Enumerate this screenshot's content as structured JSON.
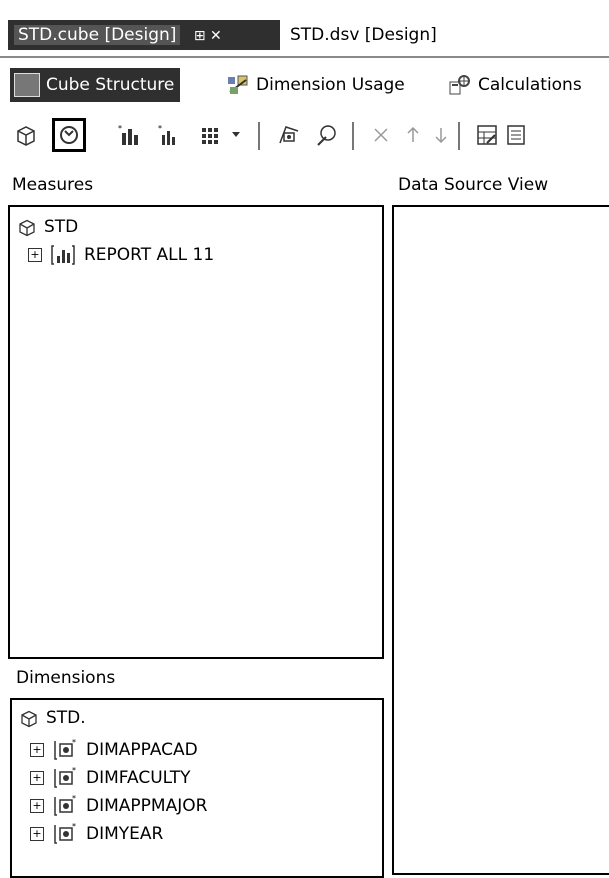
{
  "doc_tabs": [
    {
      "label": "STD.cube [Design]",
      "controls": "⊞ ✕"
    },
    {
      "label": "STD.dsv [Design]"
    }
  ],
  "sub_tabs": [
    {
      "label": "Cube Structure"
    },
    {
      "label": "Dimension Usage"
    },
    {
      "label": "Calculations"
    }
  ],
  "measures": {
    "header": "Measures",
    "root": "STD",
    "groups": [
      {
        "label": "REPORT ALL 11"
      }
    ]
  },
  "dsv": {
    "header": "Data Source View"
  },
  "dimensions": {
    "header": "Dimensions",
    "root": "STD.",
    "items": [
      {
        "label": "DIMAPPACAD"
      },
      {
        "label": "DIMFACULTY"
      },
      {
        "label": "DIMAPPMAJOR"
      },
      {
        "label": "DIMYEAR"
      }
    ]
  }
}
